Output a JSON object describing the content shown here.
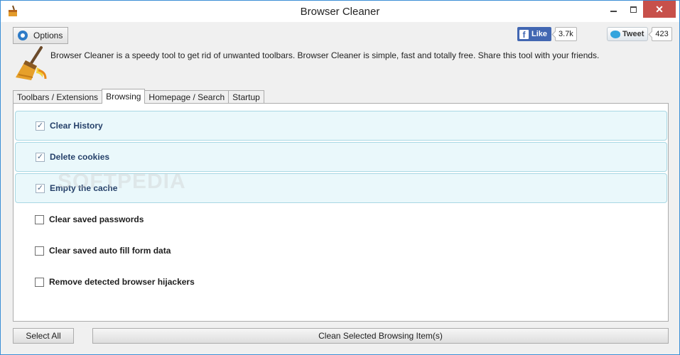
{
  "window": {
    "title": "Browser Cleaner",
    "close_label": "✕"
  },
  "toolbar": {
    "options_label": "Options"
  },
  "social": {
    "like_label": "Like",
    "like_count": "3.7k",
    "tweet_label": "Tweet",
    "tweet_count": "423",
    "fb_glyph": "f"
  },
  "description": "Browser Cleaner is a speedy tool to get rid of unwanted toolbars. Browser Cleaner is simple, fast and totally free. Share this tool with your friends.",
  "tabs": [
    {
      "label": "Toolbars / Extensions",
      "active": false
    },
    {
      "label": "Browsing",
      "active": true
    },
    {
      "label": "Homepage / Search",
      "active": false
    },
    {
      "label": "Startup",
      "active": false
    }
  ],
  "items": [
    {
      "label": "Clear History",
      "checked": true
    },
    {
      "label": "Delete cookies",
      "checked": true
    },
    {
      "label": "Empty the cache",
      "checked": true
    },
    {
      "label": "Clear saved passwords",
      "checked": false
    },
    {
      "label": "Clear saved auto fill form data",
      "checked": false
    },
    {
      "label": "Remove detected browser hijackers",
      "checked": false
    }
  ],
  "check_glyph": "✓",
  "watermark": "SOFTPEDIA",
  "buttons": {
    "select_all": "Select All",
    "clean": "Clean Selected Browsing Item(s)"
  },
  "colors": {
    "accent": "#2e7bc7",
    "close": "#c7504a",
    "facebook": "#4267b2",
    "twitter": "#33a4dd",
    "checked_bg": "#eaf8fb"
  }
}
